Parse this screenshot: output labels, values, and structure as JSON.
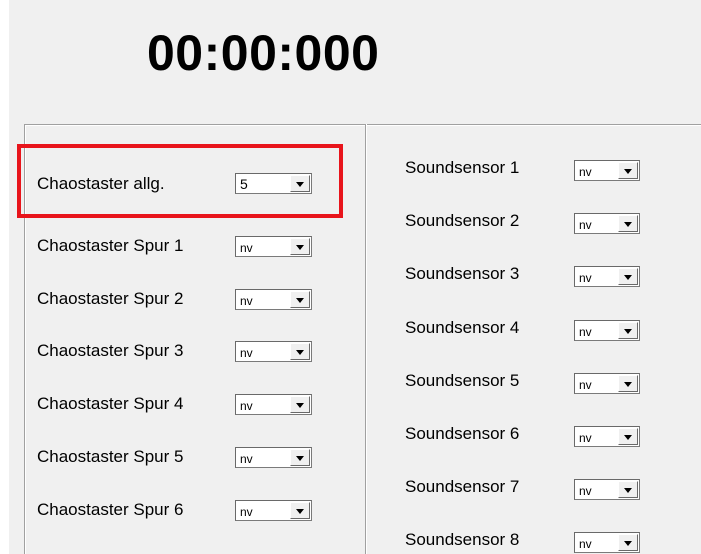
{
  "timer": "00:00:000",
  "highlight_color": "#e8141b",
  "general": {
    "label": "Chaostaster allg.",
    "value": "5"
  },
  "left_rows": [
    {
      "label": "Chaostaster Spur 1",
      "value": "nv"
    },
    {
      "label": "Chaostaster Spur 2",
      "value": "nv"
    },
    {
      "label": "Chaostaster Spur 3",
      "value": "nv"
    },
    {
      "label": "Chaostaster Spur 4",
      "value": "nv"
    },
    {
      "label": "Chaostaster Spur 5",
      "value": "nv"
    },
    {
      "label": "Chaostaster Spur 6",
      "value": "nv"
    }
  ],
  "right_rows": [
    {
      "label": "Soundsensor 1",
      "value": "nv"
    },
    {
      "label": "Soundsensor 2",
      "value": "nv"
    },
    {
      "label": "Soundsensor 3",
      "value": "nv"
    },
    {
      "label": "Soundsensor 4",
      "value": "nv"
    },
    {
      "label": "Soundsensor 5",
      "value": "nv"
    },
    {
      "label": "Soundsensor 6",
      "value": "nv"
    },
    {
      "label": "Soundsensor 7",
      "value": "nv"
    },
    {
      "label": "Soundsensor 8",
      "value": "nv"
    }
  ]
}
